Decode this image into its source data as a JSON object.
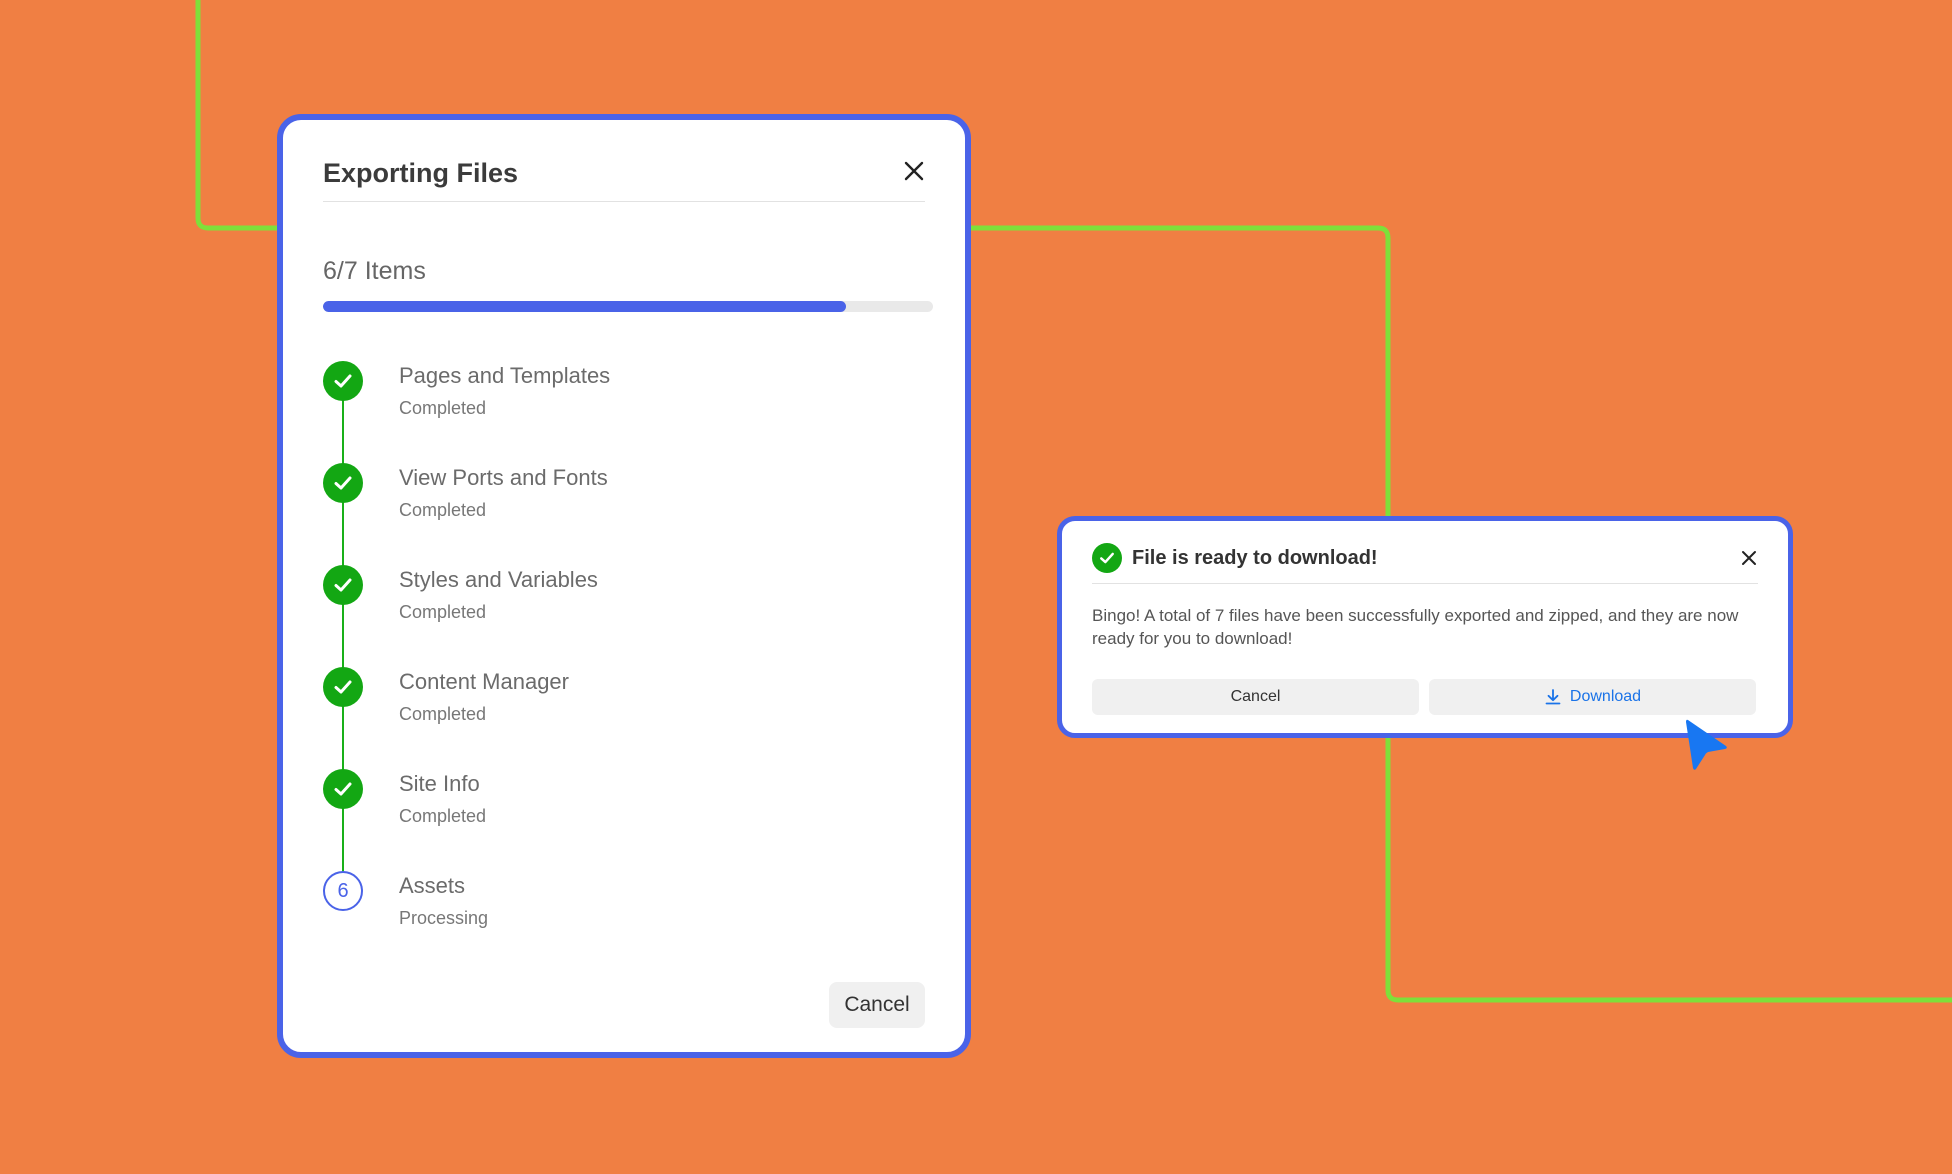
{
  "colors": {
    "background": "#f07f43",
    "accent": "#4a63e8",
    "success": "#13a713",
    "connector": "#7ee03a",
    "link": "#1a73e8"
  },
  "export_modal": {
    "title": "Exporting Files",
    "progress": {
      "label": "6/7 Items",
      "completed": 6,
      "total": 7,
      "fraction": 0.857
    },
    "steps": [
      {
        "title": "Pages and Templates",
        "status": "Completed",
        "state": "done",
        "icon": "check-icon"
      },
      {
        "title": "View Ports and Fonts",
        "status": "Completed",
        "state": "done",
        "icon": "check-icon"
      },
      {
        "title": "Styles and Variables",
        "status": "Completed",
        "state": "done",
        "icon": "check-icon"
      },
      {
        "title": "Content Manager",
        "status": "Completed",
        "state": "done",
        "icon": "check-icon"
      },
      {
        "title": "Site Info",
        "status": "Completed",
        "state": "done",
        "icon": "check-icon"
      },
      {
        "title": "Assets",
        "status": "Processing",
        "state": "active",
        "number": "6"
      }
    ],
    "cancel_label": "Cancel"
  },
  "toast": {
    "title": "File is ready to download!",
    "message": "Bingo! A total of 7 files have been successfully exported and zipped, and they are now ready for you to download!",
    "cancel_label": "Cancel",
    "download_label": "Download",
    "download_icon": "download-icon"
  }
}
